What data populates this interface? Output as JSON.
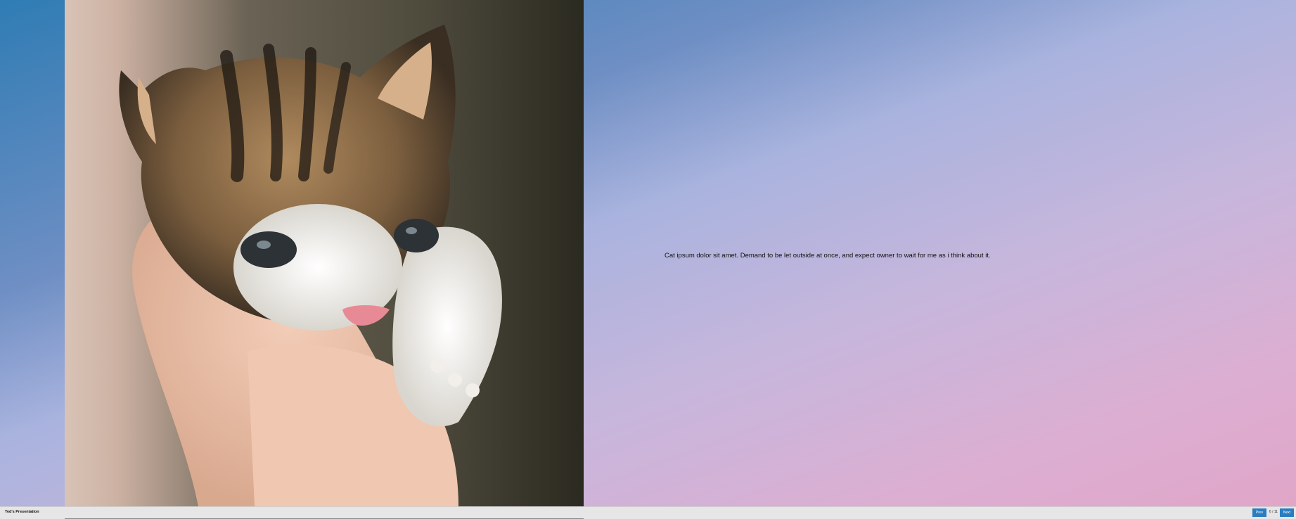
{
  "slide": {
    "caption": "Cat ipsum dolor sit amet. Demand to be let outside at once, and expect owner to wait for me as i think about it.",
    "image_subject": "kitten-photo"
  },
  "footer": {
    "title": "Ted's Presentation",
    "prev_label": "Prev",
    "page_indicator": "6 / 11",
    "next_label": "Next"
  },
  "colors": {
    "button": "#2a7dc0",
    "footer_bg": "#e6e6e6"
  }
}
